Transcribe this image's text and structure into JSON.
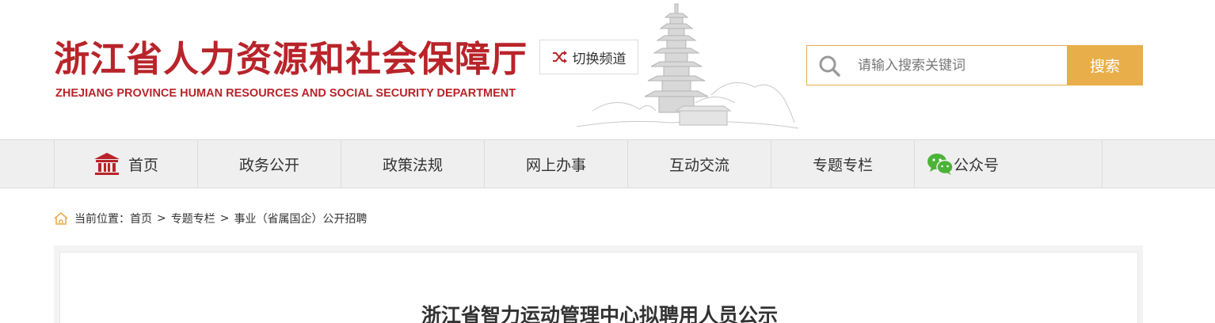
{
  "header": {
    "logo_cn": "浙江省人力资源和社会保障厅",
    "logo_en": "ZHEJIANG PROVINCE HUMAN RESOURCES AND SOCIAL SECURITY DEPARTMENT",
    "switch_channel": "切换频道",
    "brand_color": "#b8242a"
  },
  "search": {
    "placeholder": "请输入搜索关键词",
    "button": "搜索",
    "accent_color": "#e8ae4a"
  },
  "nav": {
    "items": [
      {
        "label": "首页",
        "icon": "home-icon"
      },
      {
        "label": "政务公开"
      },
      {
        "label": "政策法规"
      },
      {
        "label": "网上办事"
      },
      {
        "label": "互动交流"
      },
      {
        "label": "专题专栏"
      },
      {
        "label": "公众号",
        "icon": "wechat-icon"
      }
    ]
  },
  "breadcrumb": {
    "prefix": "当前位置：",
    "items": [
      "首页",
      "专题专栏",
      "事业（省属国企）公开招聘"
    ]
  },
  "article": {
    "title": "浙江省智力运动管理中心拟聘用人员公示"
  }
}
